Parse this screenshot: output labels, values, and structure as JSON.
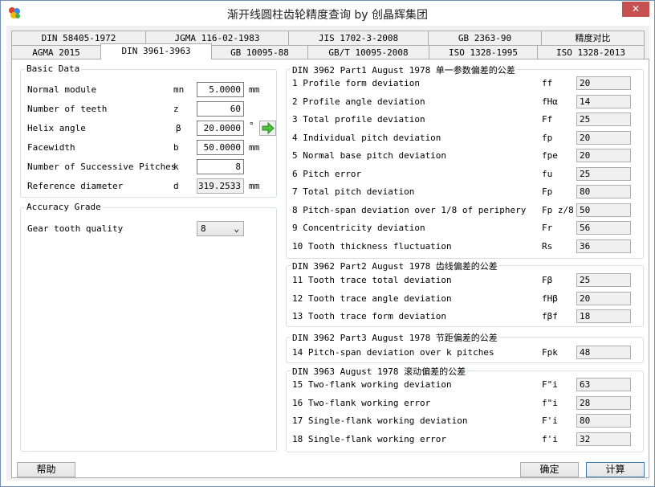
{
  "window": {
    "title": "渐开线圆柱齿轮精度查询 by 创晶辉集团"
  },
  "tabs_row1": [
    "DIN 58405-1972",
    "JGMA 116-02-1983",
    "JIS 1702-3-2008",
    "GB 2363-90",
    "精度对比"
  ],
  "tabs_row2": [
    "AGMA 2015",
    "DIN 3961-3963",
    "GB 10095-88",
    "GB/T 10095-2008",
    "ISO 1328-1995",
    "ISO 1328-2013"
  ],
  "basic": {
    "title": "Basic Data",
    "rows": [
      {
        "label": "Normal module",
        "symbol": "mn",
        "value": "5.0000",
        "unit": "mm"
      },
      {
        "label": "Number of teeth",
        "symbol": "z",
        "value": "60",
        "unit": ""
      },
      {
        "label": "Helix angle",
        "symbol": "β",
        "value": "20.0000",
        "unit": "°"
      },
      {
        "label": "Facewidth",
        "symbol": "b",
        "value": "50.0000",
        "unit": "mm"
      },
      {
        "label": "Number of Successive Pitches",
        "symbol": "k",
        "value": "8",
        "unit": ""
      },
      {
        "label": "Reference diameter",
        "symbol": "d",
        "value": "319.2533",
        "unit": "mm"
      }
    ]
  },
  "accuracy": {
    "title": "Accuracy Grade",
    "label": "Gear tooth quality",
    "value": "8"
  },
  "part1": {
    "title": "DIN 3962 Part1 August 1978 单一参数偏差的公差",
    "rows": [
      {
        "label": "1  Profile form deviation",
        "symbol": "ff",
        "value": "20"
      },
      {
        "label": "2  Profile angle deviation",
        "symbol": "fHα",
        "value": "14"
      },
      {
        "label": "3  Total profile deviation",
        "symbol": "Ff",
        "value": "25"
      },
      {
        "label": "4  Individual pitch deviation",
        "symbol": "fp",
        "value": "20"
      },
      {
        "label": "5  Normal base pitch deviation",
        "symbol": "fpe",
        "value": "20"
      },
      {
        "label": "6  Pitch error",
        "symbol": "fu",
        "value": "25"
      },
      {
        "label": "7  Total pitch deviation",
        "symbol": "Fp",
        "value": "80"
      },
      {
        "label": "8  Pitch-span deviation over 1/8 of periphery",
        "symbol": "Fp z/8",
        "value": "50"
      },
      {
        "label": "9  Concentricity deviation",
        "symbol": "Fr",
        "value": "56"
      },
      {
        "label": "10 Tooth thickness fluctuation",
        "symbol": "Rs",
        "value": "36"
      }
    ]
  },
  "part2": {
    "title": "DIN 3962 Part2 August 1978 齿线偏差的公差",
    "rows": [
      {
        "label": "11 Tooth trace total deviation",
        "symbol": "Fβ",
        "value": "25"
      },
      {
        "label": "12 Tooth trace angle deviation",
        "symbol": "fHβ",
        "value": "20"
      },
      {
        "label": "13 Tooth trace form deviation",
        "symbol": "fβf",
        "value": "18"
      }
    ]
  },
  "part3": {
    "title": "DIN 3962 Part3 August 1978 节距偏差的公差",
    "rows": [
      {
        "label": "14 Pitch-span deviation over k pitches",
        "symbol": "Fpk",
        "value": "48"
      }
    ]
  },
  "part4": {
    "title": "DIN 3963 August 1978 滚动偏差的公差",
    "rows": [
      {
        "label": "15 Two-flank working deviation",
        "symbol": "F\"i",
        "value": "63"
      },
      {
        "label": "16 Two-flank working error",
        "symbol": "f\"i",
        "value": "28"
      },
      {
        "label": "17 Single-flank working deviation",
        "symbol": "F'i",
        "value": "80"
      },
      {
        "label": "18 Single-flank working error",
        "symbol": "f'i",
        "value": "32"
      }
    ]
  },
  "buttons": {
    "help": "帮助",
    "ok": "确定",
    "calc": "计算"
  }
}
